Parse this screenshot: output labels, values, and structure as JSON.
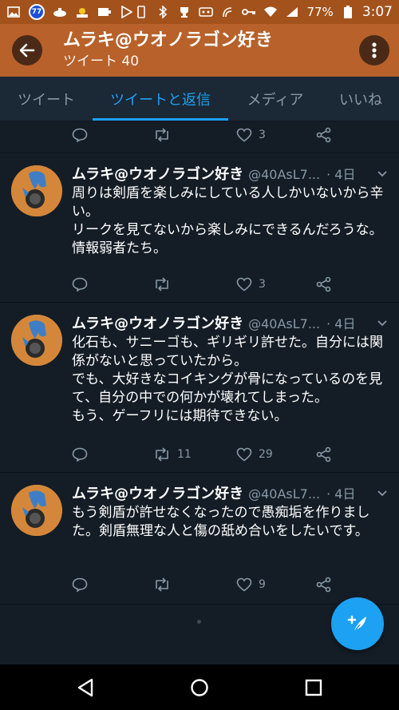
{
  "status_bar": {
    "notification_count": "77",
    "battery": "77%",
    "time": "3:07"
  },
  "header": {
    "title": "ムラキ@ウオノラゴン好き",
    "subtitle": "ツイート 40"
  },
  "tabs": [
    {
      "label": "ツイート",
      "active": false
    },
    {
      "label": "ツイートと返信",
      "active": true
    },
    {
      "label": "メディア",
      "active": false
    },
    {
      "label": "いいね",
      "active": false
    }
  ],
  "top_actions": {
    "likes": "3"
  },
  "tweets": [
    {
      "name": "ムラキ@ウオノラゴン好き",
      "handle": "@40AsL7...",
      "time": "· 4日",
      "text": "周りは剣盾を楽しみにしている人しかいないから辛い。\nリークを見てないから楽しみにできるんだろうな。情報弱者たち。",
      "retweets": "",
      "likes": "3"
    },
    {
      "name": "ムラキ@ウオノラゴン好き",
      "handle": "@40AsL7...",
      "time": "· 4日",
      "text": "化石も、サニーゴも、ギリギリ許せた。自分には関係がないと思っていたから。\nでも、大好きなコイキングが骨になっているのを見て、自分の中での何かが壊れてしまった。\nもう、ゲーフリには期待できない。",
      "retweets": "11",
      "likes": "29"
    },
    {
      "name": "ムラキ@ウオノラゴン好き",
      "handle": "@40AsL7...",
      "time": "· 4日",
      "text": "もう剣盾が許せなくなったので愚痴垢を作りました。剣盾無理な人と傷の舐め合いをしたいです。",
      "retweets": "",
      "likes": "9"
    }
  ],
  "colors": {
    "accent": "#1da1f2",
    "header": "#b8612a",
    "status_bar": "#a3521c",
    "background": "#141d26",
    "muted": "#8899a6"
  }
}
